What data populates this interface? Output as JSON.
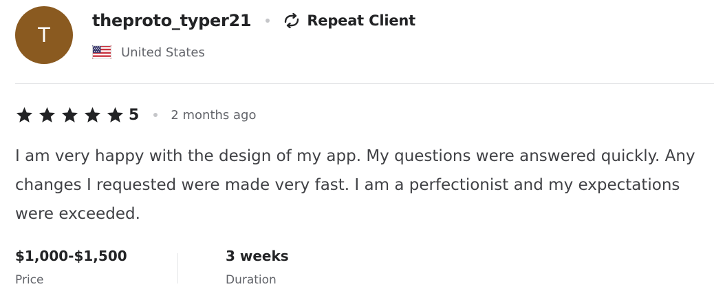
{
  "user": {
    "avatar_initial": "T",
    "avatar_color": "#8a5a20",
    "username": "theproto_typer21",
    "badge_icon": "repeat-icon",
    "badge_label": "Repeat Client",
    "country": "United States",
    "country_flag": "us-flag-icon"
  },
  "rating": {
    "stars": 5,
    "max_stars": 5,
    "value": "5",
    "time_ago": "2 months ago"
  },
  "review": {
    "text": "I am very happy with the design of my app. My questions were answered quickly. Any changes I requested were made very fast. I am a perfectionist and my expectations were exceeded."
  },
  "meta": {
    "price_value": "$1,000-$1,500",
    "price_label": "Price",
    "duration_value": "3 weeks",
    "duration_label": "Duration"
  }
}
